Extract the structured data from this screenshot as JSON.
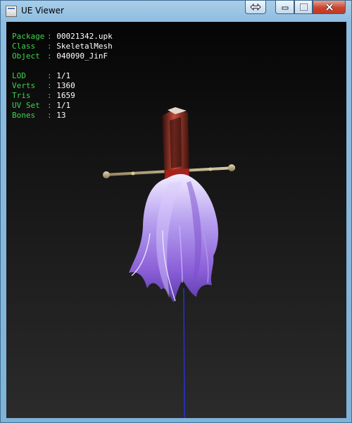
{
  "window": {
    "title": "UE Viewer"
  },
  "info": {
    "package": {
      "key": "Package",
      "value": "00021342.upk"
    },
    "class": {
      "key": "Class",
      "value": "SkeletalMesh"
    },
    "object": {
      "key": "Object",
      "value": "040090_JinF"
    },
    "lod": {
      "key": "LOD",
      "value": "1/1"
    },
    "verts": {
      "key": "Verts",
      "value": "1360"
    },
    "tris": {
      "key": "Tris",
      "value": "1659"
    },
    "uvset": {
      "key": "UV Set",
      "value": "1/1"
    },
    "bones": {
      "key": "Bones",
      "value": "13"
    },
    "separator": ": "
  },
  "icons": {
    "window_icon": "app-window-icon",
    "swap": "swap-arrows-icon",
    "minimize": "minimize-icon",
    "maximize": "maximize-icon",
    "close": "close-icon"
  },
  "colors": {
    "info_key": "#3ed44a",
    "info_value": "#ffffff",
    "skeleton_line": "#2a2fd6",
    "hair": "#a98fe8"
  }
}
